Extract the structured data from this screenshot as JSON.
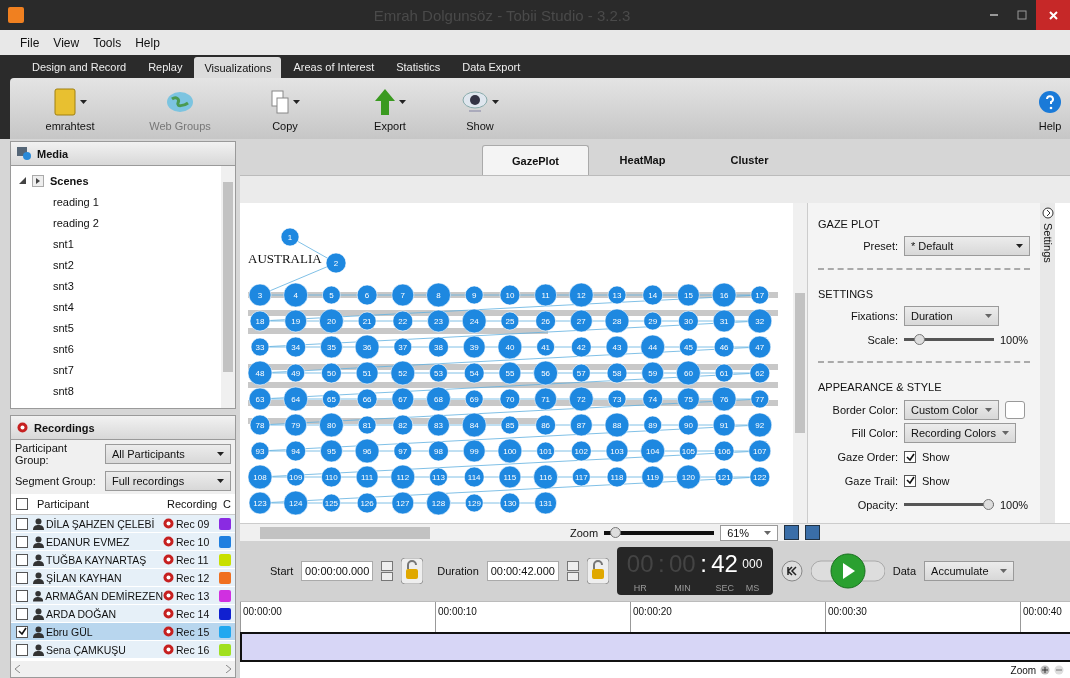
{
  "window": {
    "title": "Emrah Dolgunsöz - Tobii Studio - 3.2.3"
  },
  "menu": [
    "File",
    "View",
    "Tools",
    "Help"
  ],
  "tabs": [
    {
      "label": "Design and Record",
      "selected": false
    },
    {
      "label": "Replay",
      "selected": false
    },
    {
      "label": "Visualizations",
      "selected": true
    },
    {
      "label": "Areas of Interest",
      "selected": false
    },
    {
      "label": "Statistics",
      "selected": false
    },
    {
      "label": "Data Export",
      "selected": false
    }
  ],
  "toolbar": [
    {
      "label": "emrahtest",
      "kind": "folder",
      "dropdown": true,
      "disabled": false
    },
    {
      "label": "Web Groups",
      "kind": "globe",
      "dropdown": false,
      "disabled": true
    },
    {
      "label": "Copy",
      "kind": "copy",
      "dropdown": true,
      "disabled": false
    },
    {
      "label": "Export",
      "kind": "export",
      "dropdown": true,
      "disabled": false
    },
    {
      "label": "Show",
      "kind": "eye",
      "dropdown": true,
      "disabled": false
    }
  ],
  "help": {
    "label": "Help"
  },
  "media": {
    "title": "Media",
    "scenes": {
      "label": "Scenes",
      "expanded": true,
      "items": [
        "reading 1",
        "reading 2",
        "snt1",
        "snt2",
        "snt3",
        "snt4",
        "snt5",
        "snt6",
        "snt7",
        "snt8"
      ]
    }
  },
  "recordings": {
    "title": "Recordings",
    "participant_group": {
      "label": "Participant Group:",
      "value": "All Participants"
    },
    "segment_group": {
      "label": "Segment Group:",
      "value": "Full recordings"
    },
    "columns": [
      "Participant",
      "Recording",
      "C"
    ],
    "all_checked": false,
    "rows": [
      {
        "participant": "DİLA ŞAHZEN ÇELEBİ",
        "recording": "Rec 09",
        "color": "#8a2be2",
        "checked": false,
        "selected": false
      },
      {
        "participant": "EDANUR EVMEZ",
        "recording": "Rec 10",
        "color": "#1e7fe0",
        "checked": false,
        "selected": false
      },
      {
        "participant": "TUĞBA KAYNARTAŞ",
        "recording": "Rec 11",
        "color": "#c8e000",
        "checked": false,
        "selected": false
      },
      {
        "participant": "ŞİLAN KAYHAN",
        "recording": "Rec 12",
        "color": "#f07020",
        "checked": false,
        "selected": false
      },
      {
        "participant": "ARMAĞAN DEMİREZEN",
        "recording": "Rec 13",
        "color": "#d030e0",
        "checked": false,
        "selected": false
      },
      {
        "participant": "ARDA DOĞAN",
        "recording": "Rec 14",
        "color": "#1020d0",
        "checked": false,
        "selected": false
      },
      {
        "participant": "Ebru GÜL",
        "recording": "Rec 15",
        "color": "#20a8f0",
        "checked": true,
        "selected": true
      },
      {
        "participant": "Sena ÇAMKUŞU",
        "recording": "Rec 16",
        "color": "#a0e020",
        "checked": false,
        "selected": false
      }
    ]
  },
  "view_tabs": [
    {
      "label": "GazePlot",
      "selected": true
    },
    {
      "label": "HeatMap",
      "selected": false
    },
    {
      "label": "Cluster",
      "selected": false
    }
  ],
  "stimulus": {
    "heading": "AUSTRALIA"
  },
  "fixations": [
    "1",
    "2",
    "3",
    "4",
    "5",
    "6",
    "7",
    "8",
    "9",
    "10",
    "11",
    "12",
    "13",
    "14",
    "15",
    "16",
    "17",
    "18",
    "19",
    "20",
    "21",
    "22",
    "23",
    "24",
    "25",
    "26",
    "27",
    "28",
    "29",
    "30",
    "31",
    "32",
    "33",
    "34",
    "35",
    "36",
    "37",
    "38",
    "39",
    "40",
    "41",
    "42",
    "43",
    "44",
    "45",
    "46",
    "47",
    "48",
    "49",
    "50",
    "51",
    "52",
    "53",
    "54",
    "55",
    "56",
    "57",
    "58",
    "59",
    "60",
    "61",
    "62",
    "63",
    "64",
    "65",
    "66",
    "67",
    "68",
    "69",
    "70",
    "71",
    "72",
    "73",
    "74",
    "75",
    "76",
    "77",
    "78",
    "79",
    "80",
    "81",
    "82",
    "83",
    "84",
    "85",
    "86",
    "87",
    "88",
    "89",
    "90",
    "91",
    "92",
    "93",
    "94",
    "95",
    "96",
    "97",
    "98",
    "99",
    "100",
    "101",
    "102",
    "103",
    "104",
    "105",
    "106",
    "107",
    "108",
    "109",
    "110",
    "111",
    "112",
    "113",
    "114",
    "115",
    "116",
    "117",
    "118",
    "119",
    "120",
    "121",
    "122",
    "123",
    "124",
    "125",
    "126",
    "127",
    "128",
    "129",
    "130",
    "131"
  ],
  "settings": {
    "side_tab": "Settings",
    "title": "GAZE PLOT",
    "preset": {
      "label": "Preset:",
      "value": "* Default"
    },
    "settings_title": "SETTINGS",
    "fixations": {
      "label": "Fixations:",
      "value": "Duration"
    },
    "scale": {
      "label": "Scale:",
      "level": 0.12,
      "reading": "100%"
    },
    "appearance_title": "APPEARANCE & STYLE",
    "border_color": {
      "label": "Border Color:",
      "value": "Custom Color"
    },
    "fill_color": {
      "label": "Fill Color:",
      "value": "Recording Colors"
    },
    "gaze_order": {
      "label": "Gaze Order:",
      "text": "Show",
      "checked": true
    },
    "gaze_trail": {
      "label": "Gaze Trail:",
      "text": "Show",
      "checked": true
    },
    "opacity": {
      "label": "Opacity:",
      "level": 1,
      "reading": "100%"
    }
  },
  "zoom": {
    "label": "Zoom",
    "level": 0.05,
    "value": "61%"
  },
  "playback": {
    "start_label": "Start",
    "start": "00:00:00.000",
    "duration_label": "Duration",
    "duration": "00:00:42.000",
    "clock": {
      "hr": "00",
      "min": "00",
      "sec": "42",
      "ms": "000",
      "separator": ":",
      "units": [
        "HR",
        "MIN",
        "SEC",
        "MS"
      ]
    },
    "data_label": "Data",
    "data": "Accumulate"
  },
  "timeline": {
    "ticks": [
      "00:00:00",
      "00:00:10",
      "00:00:20",
      "00:00:30",
      "00:00:40"
    ],
    "zoom_label": "Zoom"
  }
}
